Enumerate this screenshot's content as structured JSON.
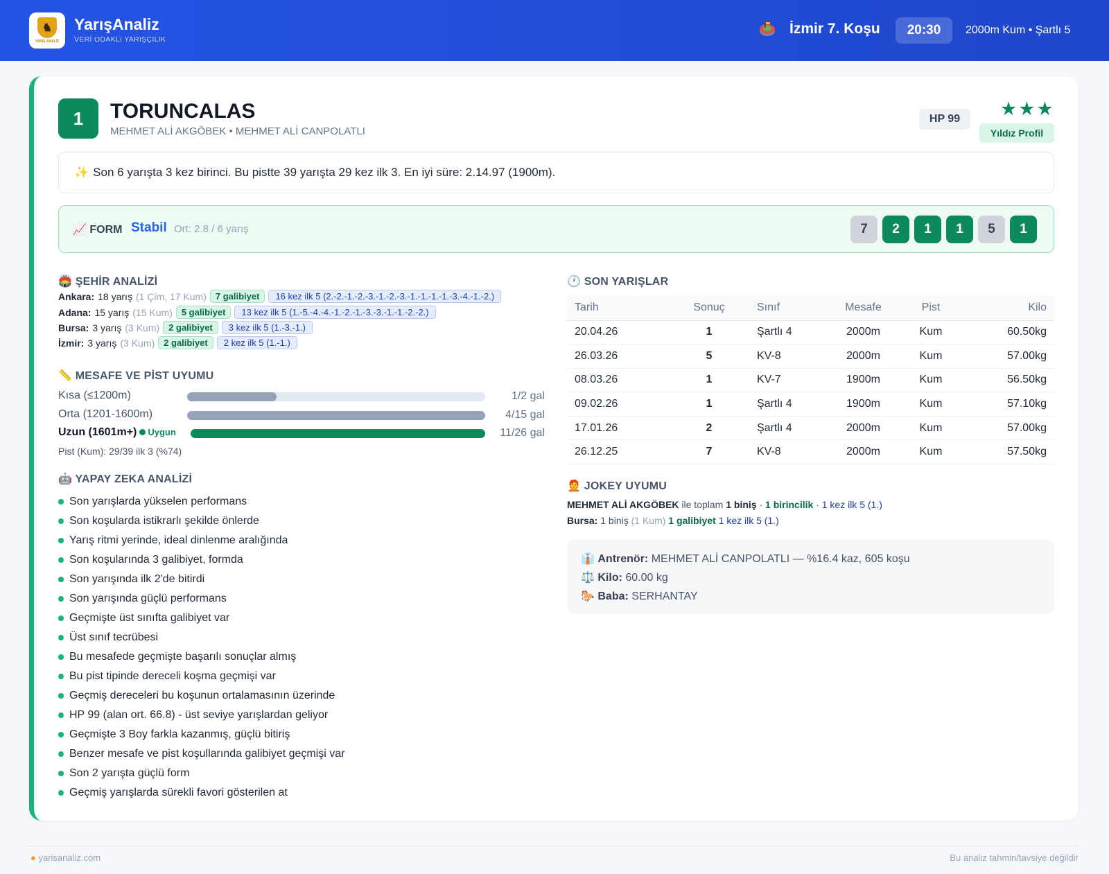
{
  "header": {
    "brand": "YarışAnaliz",
    "brand_sub": "VERİ ODAKLI YARIŞÇILIK",
    "logo_text": "YARIŞ ANALİZ",
    "race_title": "İzmir 7. Koşu",
    "race_time": "20:30",
    "race_meta": "2000m Kum • Şartlı 5"
  },
  "horse": {
    "number": "1",
    "name": "TORUNCALAS",
    "sub": "MEHMET ALİ AKGÖBEK • MEHMET ALİ CANPOLATLI",
    "hp": "HP 99",
    "stars": "★★★",
    "profile": "Yıldız Profil",
    "summary": "Son 6 yarışta 3 kez birinci. Bu pistte 39 yarışta 29 kez ilk 3. En iyi süre: 2.14.97 (1900m).",
    "summary_icon": "sparkles-icon"
  },
  "form": {
    "label": "FORM",
    "status": "Stabil",
    "avg": "Ort: 2.8 / 6 yarış",
    "results": [
      "7",
      "2",
      "1",
      "1",
      "5",
      "1"
    ]
  },
  "city": {
    "title": "ŞEHİR ANALİZİ",
    "rows": [
      {
        "city": "Ankara:",
        "races": "18 yarış",
        "detail": "(1 Çim, 17 Kum)",
        "wins": "7 galibiyet",
        "top5": "16 kez ilk 5 (2.-2.-1.-2.-3.-1.-2.-3.-1.-1.-1.-1.-3.-4.-1.-2.)"
      },
      {
        "city": "Adana:",
        "races": "15 yarış",
        "detail": "(15 Kum)",
        "wins": "5 galibiyet",
        "top5": "13 kez ilk 5 (1.-5.-4.-4.-1.-2.-1.-3.-3.-1.-1.-2.-2.)"
      },
      {
        "city": "Bursa:",
        "races": "3 yarış",
        "detail": "(3 Kum)",
        "wins": "2 galibiyet",
        "top5": "3 kez ilk 5 (1.-3.-1.)"
      },
      {
        "city": "İzmir:",
        "races": "3 yarış",
        "detail": "(3 Kum)",
        "wins": "2 galibiyet",
        "top5": "2 kez ilk 5 (1.-1.)"
      }
    ]
  },
  "distance": {
    "title": "MESAFE VE PİST UYUMU",
    "rows": [
      {
        "label": "Kısa (≤1200m)",
        "value": "1/2 gal",
        "fill": 0.3,
        "color": "#94a3b8",
        "strong": false,
        "tag": ""
      },
      {
        "label": "Orta (1201-1600m)",
        "value": "4/15 gal",
        "fill": 1.0,
        "color": "#94a3b8",
        "strong": false,
        "tag": ""
      },
      {
        "label": "Uzun (1601m+)",
        "value": "11/26 gal",
        "fill": 1.0,
        "color": "#0d8a5c",
        "strong": true,
        "tag": "Uygun"
      }
    ],
    "pist": "Pist (Kum): 29/39 ilk 3 (%74)"
  },
  "ai": {
    "title": "YAPAY ZEKA ANALİZİ",
    "items": [
      "Son yarışlarda yükselen performans",
      "Son koşularda istikrarlı şekilde önlerde",
      "Yarış ritmi yerinde, ideal dinlenme aralığında",
      "Son koşularında 3 galibiyet, formda",
      "Son yarışında ilk 2'de bitirdi",
      "Son yarışında güçlü performans",
      "Geçmişte üst sınıfta galibiyet var",
      "Üst sınıf tecrübesi",
      "Bu mesafede geçmişte başarılı sonuçlar almış",
      "Bu pist tipinde dereceli koşma geçmişi var",
      "Geçmiş dereceleri bu koşunun ortalamasının üzerinde",
      "HP 99 (alan ort. 66.8) - üst seviye yarışlardan geliyor",
      "Geçmişte 3 Boy farkla kazanmış, güçlü bitiriş",
      "Benzer mesafe ve pist koşullarında galibiyet geçmişi var",
      "Son 2 yarışta güçlü form",
      "Geçmiş yarışlarda sürekli favori gösterilen at"
    ]
  },
  "races": {
    "title": "SON YARIŞLAR",
    "headers": [
      "Tarih",
      "Sonuç",
      "Sınıf",
      "Mesafe",
      "Pist",
      "Kilo"
    ],
    "rows": [
      {
        "date": "20.04.26",
        "res": "1",
        "cls": "Şartlı 4",
        "dist": "2000m",
        "pist": "Kum",
        "kilo": "60.50kg"
      },
      {
        "date": "26.03.26",
        "res": "5",
        "cls": "KV-8",
        "dist": "2000m",
        "pist": "Kum",
        "kilo": "57.00kg"
      },
      {
        "date": "08.03.26",
        "res": "1",
        "cls": "KV-7",
        "dist": "1900m",
        "pist": "Kum",
        "kilo": "56.50kg"
      },
      {
        "date": "09.02.26",
        "res": "1",
        "cls": "Şartlı 4",
        "dist": "1900m",
        "pist": "Kum",
        "kilo": "57.10kg"
      },
      {
        "date": "17.01.26",
        "res": "2",
        "cls": "Şartlı 4",
        "dist": "2000m",
        "pist": "Kum",
        "kilo": "57.00kg"
      },
      {
        "date": "26.12.25",
        "res": "7",
        "cls": "KV-8",
        "dist": "2000m",
        "pist": "Kum",
        "kilo": "57.50kg"
      }
    ]
  },
  "jockey": {
    "title": "JOKEY UYUMU",
    "name": "MEHMET ALİ AKGÖBEK",
    "l1_mid": "ile toplam",
    "rides": "1 biniş",
    "sep": "·",
    "firsts": "1 birincilik",
    "top5": "1 kez ilk 5 (1.)",
    "city": "Bursa:",
    "city_rides": "1 biniş",
    "city_detail": "(1 Kum)",
    "city_wins": "1 galibiyet",
    "city_top5": "1 kez ilk 5 (1.)"
  },
  "info": {
    "trainer_label": "Antrenör:",
    "trainer": "MEHMET ALİ CANPOLATLI — %16.4 kaz, 605 koşu",
    "weight_label": "Kilo:",
    "weight": "60.00 kg",
    "sire_label": "Baba:",
    "sire": "SERHANTAY"
  },
  "footer": {
    "site": "yarisanaliz.com",
    "disclaimer": "Bu analiz tahmin/tavsiye değildir"
  },
  "colors": {
    "accent": "#2454e6",
    "win": "#0d8a5c",
    "second": "#ea7a0c",
    "card_border": "#17b37a"
  }
}
